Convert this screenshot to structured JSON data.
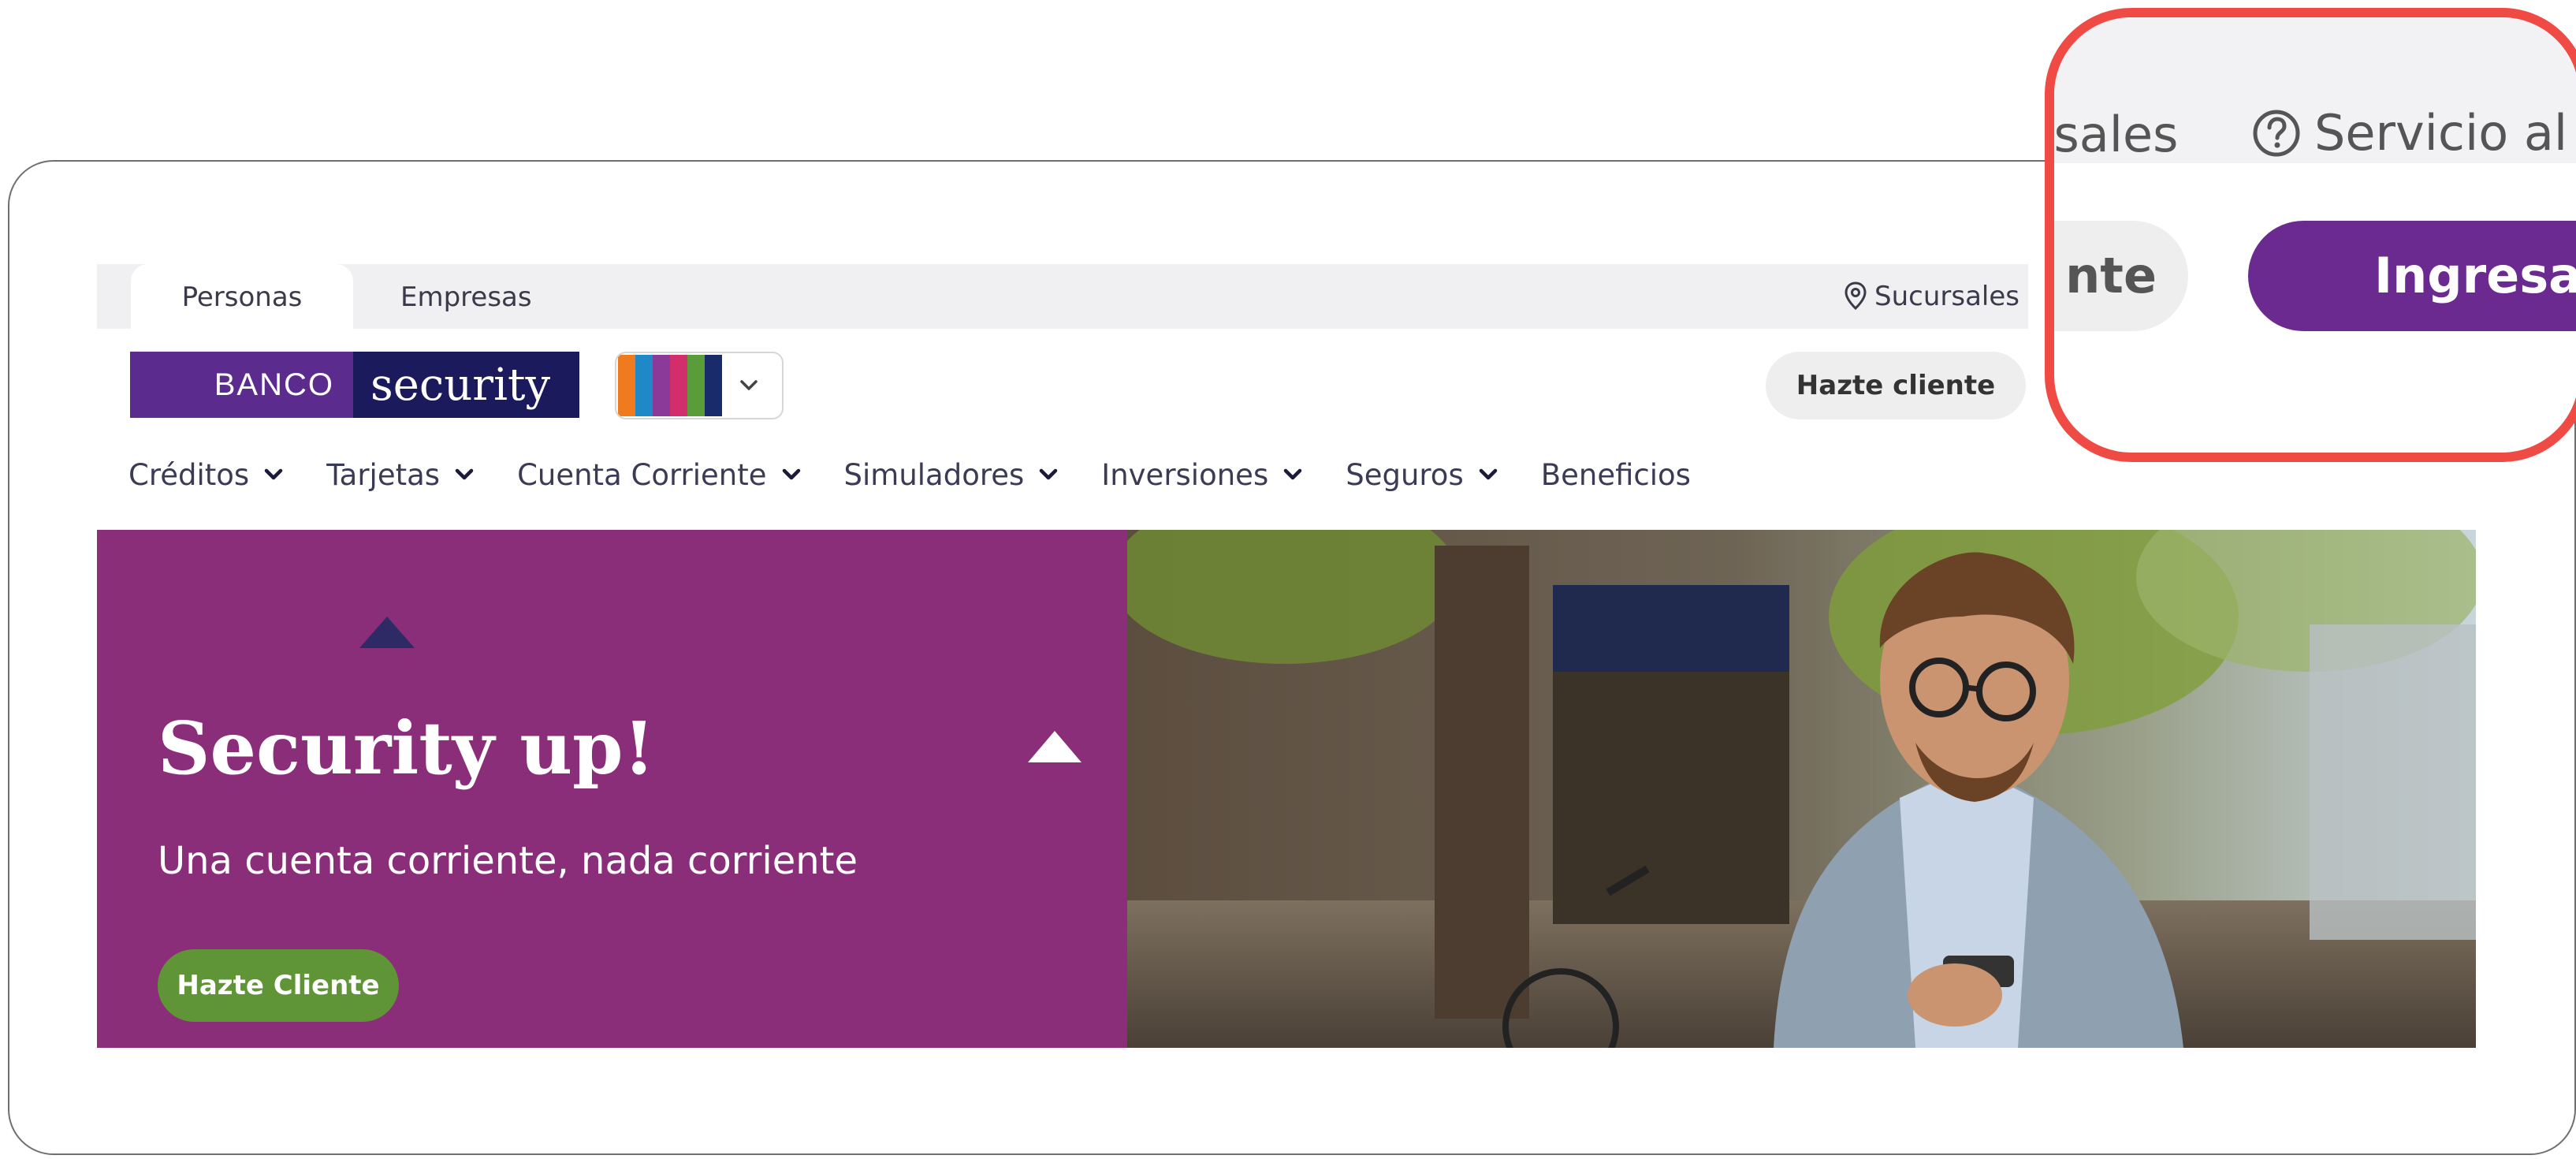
{
  "tabs": [
    {
      "label": "Personas",
      "active": true
    },
    {
      "label": "Empresas",
      "active": false
    }
  ],
  "top_links": {
    "sucursales": "Sucursales"
  },
  "logo": {
    "left_text": "BANCO",
    "right_text": "security"
  },
  "color_picker": {
    "stripes": [
      "#f07b1e",
      "#1f89c8",
      "#8b3a9a",
      "#d12e6b",
      "#5a9b3a",
      "#1a2b6b"
    ],
    "chevron_icon": "chevron-down-icon"
  },
  "header": {
    "hazte_cliente": "Hazte cliente"
  },
  "nav": [
    {
      "label": "Créditos",
      "dropdown": true
    },
    {
      "label": "Tarjetas",
      "dropdown": true
    },
    {
      "label": "Cuenta Corriente",
      "dropdown": true
    },
    {
      "label": "Simuladores",
      "dropdown": true
    },
    {
      "label": "Inversiones",
      "dropdown": true
    },
    {
      "label": "Seguros",
      "dropdown": true
    },
    {
      "label": "Beneficios",
      "dropdown": false
    }
  ],
  "hero": {
    "title": "Security up!",
    "subtitle": "Una cuenta corriente, nada corriente",
    "cta": "Hazte Cliente",
    "bg_color": "#8a2e79",
    "cta_color": "#5f9437"
  },
  "zoom_callout": {
    "sucursales_fragment": "rsales",
    "help": "Servicio al Cl",
    "hazte_fragment": "nte",
    "ingresar": "Ingresar",
    "border_color": "#f04a45",
    "ingresar_color": "#6b2a8f"
  }
}
